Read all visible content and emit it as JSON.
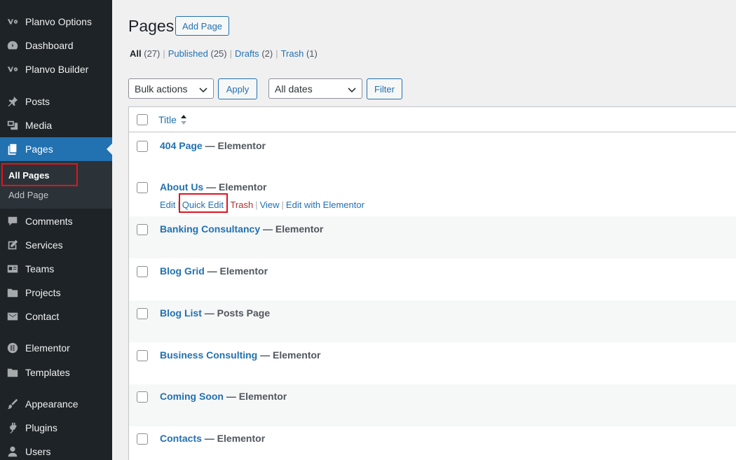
{
  "sidebar": {
    "items": [
      {
        "label": "Planvo Options",
        "icon": "planvo-icon"
      },
      {
        "label": "Dashboard",
        "icon": "dashboard-icon"
      },
      {
        "label": "Planvo Builder",
        "icon": "planvo-icon"
      },
      {
        "label": "Posts",
        "icon": "pin-icon"
      },
      {
        "label": "Media",
        "icon": "media-icon"
      },
      {
        "label": "Pages",
        "icon": "pages-icon"
      },
      {
        "label": "Comments",
        "icon": "comment-icon"
      },
      {
        "label": "Services",
        "icon": "edit-icon"
      },
      {
        "label": "Teams",
        "icon": "id-card-icon"
      },
      {
        "label": "Projects",
        "icon": "folder-icon"
      },
      {
        "label": "Contact",
        "icon": "mail-icon"
      },
      {
        "label": "Elementor",
        "icon": "elementor-icon"
      },
      {
        "label": "Templates",
        "icon": "folder-icon"
      },
      {
        "label": "Appearance",
        "icon": "brush-icon"
      },
      {
        "label": "Plugins",
        "icon": "plugin-icon"
      },
      {
        "label": "Users",
        "icon": "user-icon"
      }
    ],
    "submenu": {
      "all_pages": "All Pages",
      "add_page": "Add Page"
    }
  },
  "header": {
    "title": "Pages",
    "add_button": "Add Page"
  },
  "filters": {
    "all": "All",
    "all_count": "(27)",
    "published": "Published",
    "published_count": "(25)",
    "drafts": "Drafts",
    "drafts_count": "(2)",
    "trash": "Trash",
    "trash_count": "(1)"
  },
  "toolbar": {
    "bulk_actions": "Bulk actions",
    "apply": "Apply",
    "dates": "All dates",
    "filter": "Filter"
  },
  "table": {
    "column_title": "Title",
    "rows": [
      {
        "title": "404 Page",
        "state": "— Elementor"
      },
      {
        "title": "About Us",
        "state": "— Elementor"
      },
      {
        "title": "Banking Consultancy",
        "state": "— Elementor"
      },
      {
        "title": "Blog Grid",
        "state": "— Elementor"
      },
      {
        "title": "Blog List",
        "state": "— Posts Page"
      },
      {
        "title": "Business Consulting",
        "state": "— Elementor"
      },
      {
        "title": "Coming Soon",
        "state": "— Elementor"
      },
      {
        "title": "Contacts",
        "state": "— Elementor"
      }
    ],
    "row_actions": {
      "edit": "Edit",
      "quick_edit": "Quick Edit",
      "trash": "Trash",
      "view": "View",
      "edit_with_elementor": "Edit with Elementor"
    }
  },
  "colors": {
    "accent": "#2271b1",
    "sidebar": "#1d2327",
    "highlight": "#e0141e",
    "trash": "#b32d2e"
  }
}
